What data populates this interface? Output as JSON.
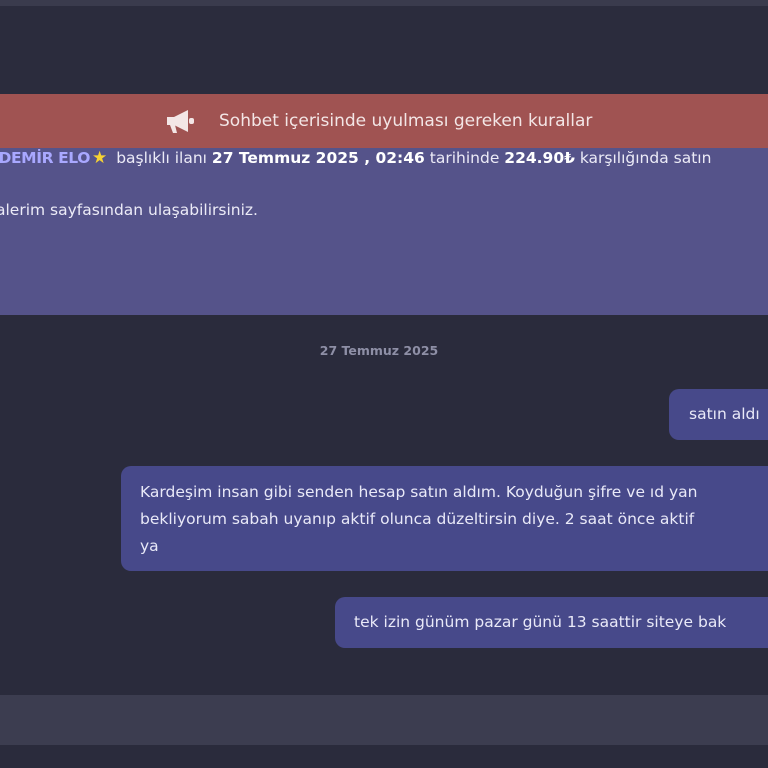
{
  "rules_banner": {
    "icon": "megaphone-icon",
    "label": "Sohbet içerisinde uyulması gereken kurallar",
    "color": "#a05352"
  },
  "order_info": {
    "item_title": "R DEMİR ELO",
    "star": "★",
    "text_1": "başlıklı ilanı",
    "date_time": "27 Temmuz 2025 , 02:46",
    "text_2": "tarihinde",
    "price": "224.90₺",
    "text_3": "karşılığında satın",
    "line2": "alerim sayfasından ulaşabilirsiniz.",
    "color": "#55538a"
  },
  "chat": {
    "date_separator": "27 Temmuz 2025",
    "messages": [
      {
        "lines": [
          "satın aldı"
        ]
      },
      {
        "lines": [
          "Kardeşim insan gibi senden hesap satın aldım. Koyduğun şifre ve ıd yan",
          "bekliyorum sabah uyanıp aktif olunca düzeltirsin diye. 2 saat önce aktif",
          "ya"
        ]
      },
      {
        "lines": [
          "tek izin günüm pazar günü 13 saattir siteye bak"
        ]
      }
    ],
    "bubble_color": "#47498a"
  },
  "composer": {
    "placeholder": ""
  }
}
